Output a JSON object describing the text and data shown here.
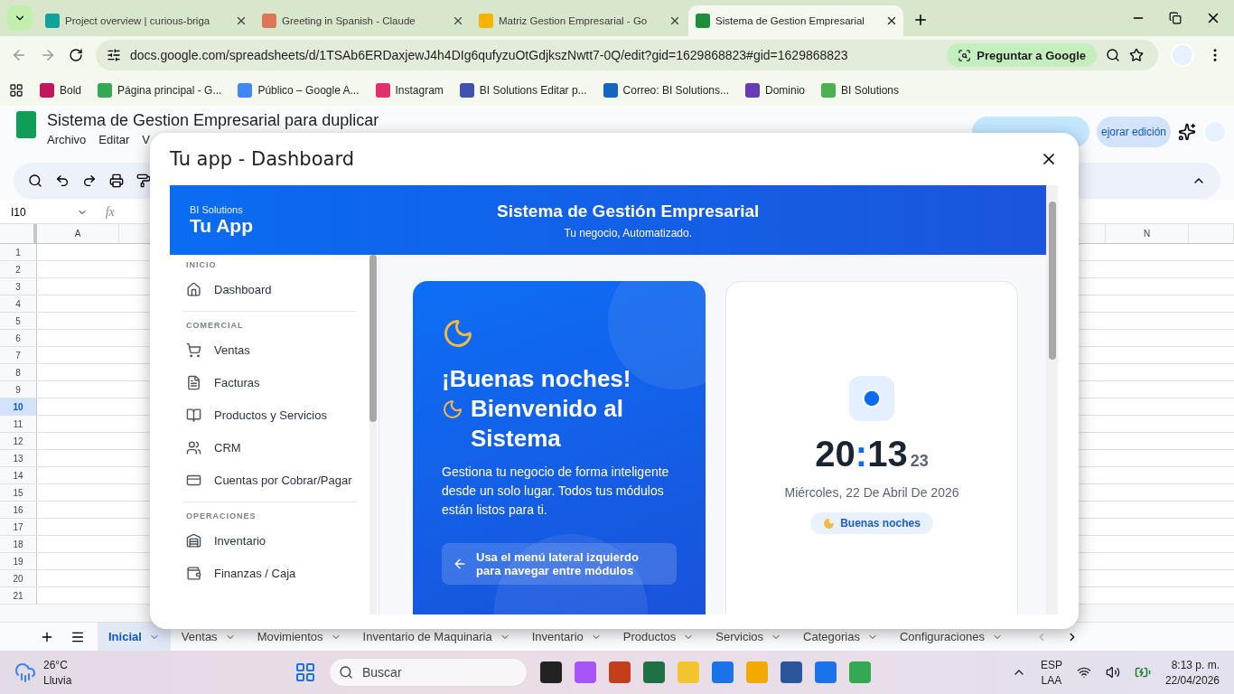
{
  "browser": {
    "tabs": [
      {
        "title": "Project overview | curious-briga",
        "selected": false
      },
      {
        "title": "Greeting in Spanish - Claude",
        "selected": false
      },
      {
        "title": "Matriz Gestion Empresarial - Go",
        "selected": false
      },
      {
        "title": "Sistema de Gestion Empresarial",
        "selected": true
      }
    ],
    "url": "docs.google.com/spreadsheets/d/1TSAb6ERDaxjewJ4h4DIg6qufyzuOtGdjkszNwtt7-0Q/edit?gid=1629868823#gid=1629868823",
    "ask_button": "Preguntar a Google",
    "bookmarks": [
      "Bold",
      "Página principal - G...",
      "Público – Google A...",
      "Instagram",
      "BI Solutions Editar p...",
      "Correo: BI Solutions...",
      "Dominio",
      "BI Solutions"
    ]
  },
  "sheet": {
    "title": "Sistema de Gestion Empresarial para duplicar",
    "menu": [
      "Archivo",
      "Editar",
      "V"
    ],
    "improve_button": "ejorar edición",
    "cell_ref": "I10",
    "fx": "fx",
    "columns": [
      "A",
      "N"
    ],
    "rows": [
      {
        "label": "1",
        "selected": false
      },
      {
        "label": "2",
        "selected": false
      },
      {
        "label": "3",
        "selected": false
      },
      {
        "label": "4",
        "selected": false
      },
      {
        "label": "5",
        "selected": false
      },
      {
        "label": "6",
        "selected": false
      },
      {
        "label": "7",
        "selected": false
      },
      {
        "label": "8",
        "selected": false
      },
      {
        "label": "9",
        "selected": false
      },
      {
        "label": "10",
        "selected": true
      },
      {
        "label": "11",
        "selected": false
      },
      {
        "label": "12",
        "selected": false
      },
      {
        "label": "13",
        "selected": false
      },
      {
        "label": "14",
        "selected": false
      },
      {
        "label": "15",
        "selected": false
      },
      {
        "label": "16",
        "selected": false
      },
      {
        "label": "17",
        "selected": false
      },
      {
        "label": "18",
        "selected": false
      },
      {
        "label": "19",
        "selected": false
      },
      {
        "label": "20",
        "selected": false
      },
      {
        "label": "21",
        "selected": false
      }
    ],
    "tabs": [
      {
        "label": "Inicial",
        "selected": true
      },
      {
        "label": "Ventas",
        "selected": false
      },
      {
        "label": "Movimientos",
        "selected": false
      },
      {
        "label": "Inventario de Maquinaria",
        "selected": false
      },
      {
        "label": "Inventario",
        "selected": false
      },
      {
        "label": "Productos",
        "selected": false
      },
      {
        "label": "Servicios",
        "selected": false
      },
      {
        "label": "Categorias",
        "selected": false
      },
      {
        "label": "Configuraciones",
        "selected": false
      }
    ]
  },
  "dialog": {
    "title": "Tu app - Dashboard",
    "header": {
      "brand": "BI Solutions",
      "app_name": "Tu App",
      "title": "Sistema de Gestión Empresarial",
      "subtitle": "Tu negocio, Automatizado."
    },
    "sidebar": [
      {
        "section": "INICIO",
        "items": [
          {
            "label": "Dashboard",
            "selected": false
          }
        ]
      },
      {
        "section": "COMERCIAL",
        "items": [
          {
            "label": "Ventas",
            "selected": false
          },
          {
            "label": "Facturas",
            "selected": false
          },
          {
            "label": "Productos y Servicios",
            "selected": false
          },
          {
            "label": "CRM",
            "selected": false
          },
          {
            "label": "Cuentas por Cobrar/Pagar",
            "selected": false
          }
        ]
      },
      {
        "section": "OPERACIONES",
        "items": [
          {
            "label": "Inventario",
            "selected": false
          },
          {
            "label": "Finanzas / Caja",
            "selected": false
          }
        ]
      }
    ],
    "welcome": {
      "greeting": "¡Buenas noches!",
      "welcome": "Bienvenido al Sistema",
      "description": "Gestiona tu negocio de forma inteligente desde un solo lugar. Todos tus módulos están listos para ti.",
      "hint": "Usa el menú lateral izquierdo para navegar entre módulos"
    },
    "clock": {
      "hours": "20",
      "separator": ":",
      "minutes": "13",
      "seconds": "23",
      "date": "Miércoles, 22 De Abril De 2026",
      "badge": "Buenas noches"
    }
  },
  "taskbar": {
    "temperature": "26°C",
    "weather": "Lluvia",
    "search_placeholder": "Buscar",
    "language": "ESP",
    "layout": "LAA",
    "time": "8:13 p. m.",
    "date": "22/04/2026"
  }
}
